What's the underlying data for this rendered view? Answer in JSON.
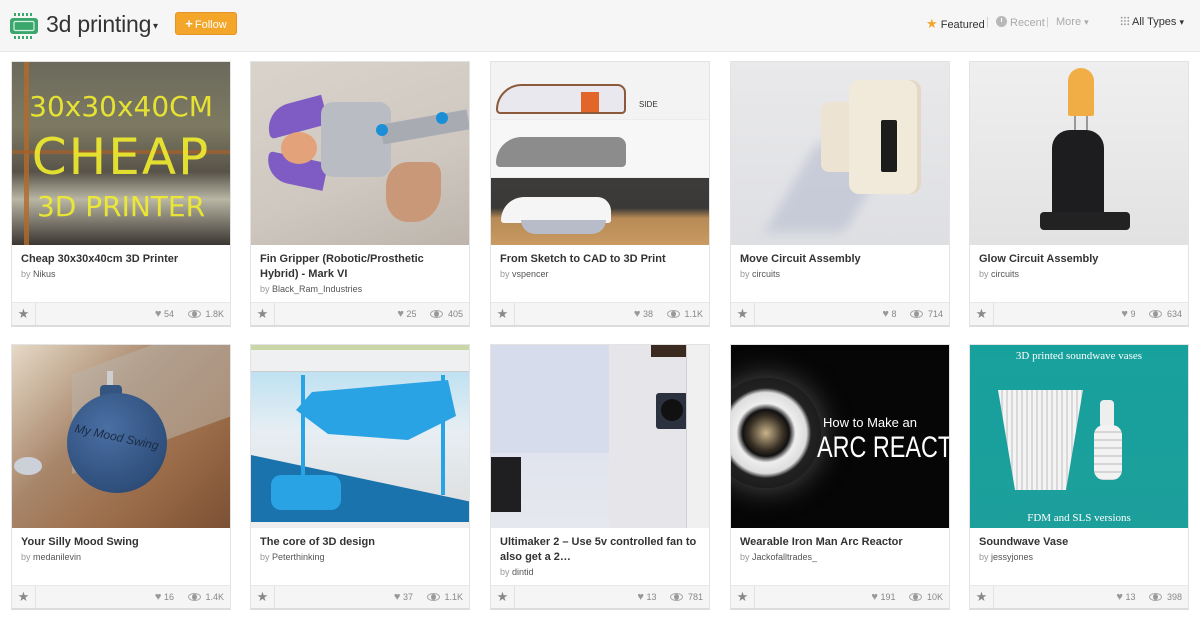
{
  "header": {
    "channel_title": "3d printing",
    "follow_label": "Follow",
    "sort": {
      "featured": "Featured",
      "recent": "Recent",
      "more": "More",
      "types": "All Types",
      "separator": "|"
    }
  },
  "icons": {
    "channel": "circuit-board-icon",
    "caret": "▾",
    "star": "★",
    "heart": "♥",
    "plus": "+"
  },
  "colors": {
    "accent_orange": "#f4a62a",
    "channel_icon_green": "#3aa76d",
    "header_bg": "#f6f6f6"
  },
  "cards": [
    {
      "title": "Cheap 30x30x40cm 3D Printer",
      "by": "by",
      "author": "Nikus",
      "favorites": "54",
      "views": "1.8K",
      "thumb_text": [
        "30x30x40CM",
        "CHEAP",
        "3D PRINTER"
      ]
    },
    {
      "title": "Fin Gripper (Robotic/Prosthetic Hybrid) - Mark VI",
      "by": "by",
      "author": "Black_Ram_Industries",
      "favorites": "25",
      "views": "405"
    },
    {
      "title": "From Sketch to CAD to 3D Print",
      "by": "by",
      "author": "vspencer",
      "favorites": "38",
      "views": "1.1K",
      "thumb_text": [
        "SIDE"
      ]
    },
    {
      "title": "Move Circuit Assembly",
      "by": "by",
      "author": "circuits",
      "favorites": "8",
      "views": "714"
    },
    {
      "title": "Glow Circuit Assembly",
      "by": "by",
      "author": "circuits",
      "favorites": "9",
      "views": "634"
    },
    {
      "title": "Your Silly Mood Swing",
      "by": "by",
      "author": "medanilevin",
      "favorites": "16",
      "views": "1.4K",
      "thumb_text": [
        "My Mood Swing"
      ]
    },
    {
      "title": "The core of 3D design",
      "by": "by",
      "author": "Peterthinking",
      "favorites": "37",
      "views": "1.1K"
    },
    {
      "title": "Ultimaker 2 – Use 5v controlled fan to also get a 2…",
      "by": "by",
      "author": "dintid",
      "favorites": "13",
      "views": "781"
    },
    {
      "title": "Wearable Iron Man Arc Reactor",
      "by": "by",
      "author": "Jackofalltrades_",
      "favorites": "191",
      "views": "10K",
      "thumb_text": [
        "How to Make an",
        "ARC REACTOR"
      ]
    },
    {
      "title": "Soundwave Vase",
      "by": "by",
      "author": "jessyjones",
      "favorites": "13",
      "views": "398",
      "thumb_text": [
        "3D printed soundwave vases",
        "FDM and SLS versions"
      ]
    }
  ]
}
